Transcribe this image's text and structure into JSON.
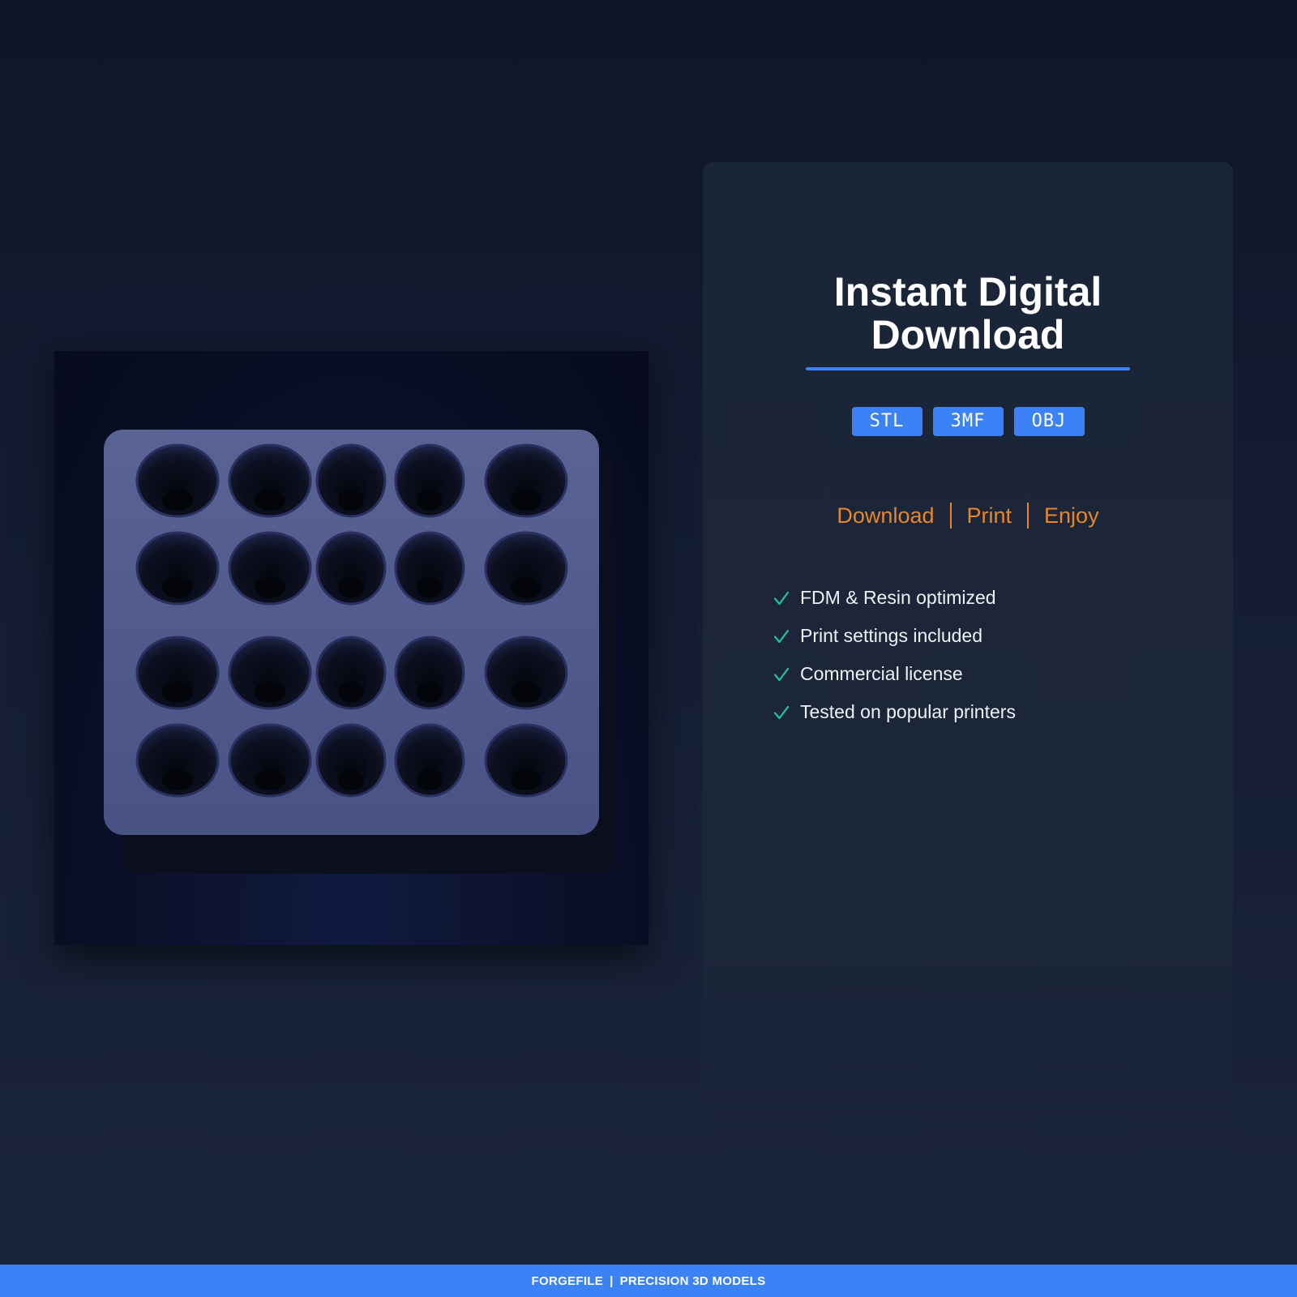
{
  "product_image": {
    "icon": "hole-tray-3d-model",
    "rows": 4,
    "columns": 5
  },
  "card": {
    "title_line1": "Instant Digital",
    "title_line2": "Download",
    "formats": [
      "STL",
      "3MF",
      "OBJ"
    ],
    "workflow": [
      "Download",
      "Print",
      "Enjoy"
    ],
    "features": [
      "FDM & Resin optimized",
      "Print settings included",
      "Commercial license",
      "Tested on popular printers"
    ]
  },
  "footer": {
    "brand": "FORGEFILE",
    "separator": "|",
    "tagline": "PRECISION 3D MODELS"
  },
  "colors": {
    "accent": "#3b82f6",
    "workflow": "#e8862b",
    "check": "#22c3a6",
    "background": "#141d33",
    "card": "#1b2538"
  }
}
